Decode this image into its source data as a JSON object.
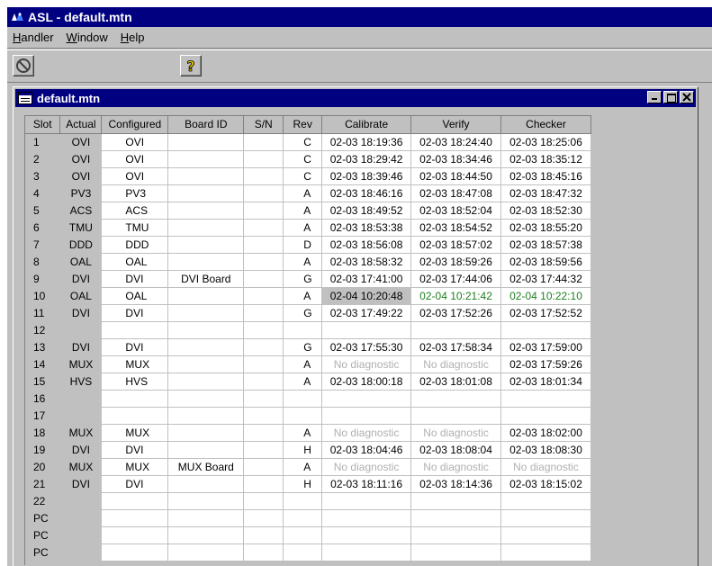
{
  "app": {
    "title": "ASL - default.mtn",
    "logo_text": "ASL"
  },
  "menu": [
    {
      "label": "Handler",
      "underline": "H",
      "rest": "andler"
    },
    {
      "label": "Window",
      "underline": "W",
      "rest": "indow"
    },
    {
      "label": "Help",
      "underline": "H",
      "rest": "elp"
    }
  ],
  "child": {
    "title": "default.mtn"
  },
  "grid": {
    "headers": [
      "Slot",
      "Actual",
      "Configured",
      "Board ID",
      "S/N",
      "Rev",
      "Calibrate",
      "Verify",
      "Checker"
    ],
    "rows": [
      {
        "slot": "1",
        "actual": "OVI",
        "configured": "OVI",
        "board_id": "",
        "sn": "",
        "rev": "C",
        "calibrate": "02-03 18:19:36",
        "verify": "02-03 18:24:40",
        "checker": "02-03 18:25:06"
      },
      {
        "slot": "2",
        "actual": "OVI",
        "configured": "OVI",
        "board_id": "",
        "sn": "",
        "rev": "C",
        "calibrate": "02-03 18:29:42",
        "verify": "02-03 18:34:46",
        "checker": "02-03 18:35:12"
      },
      {
        "slot": "3",
        "actual": "OVI",
        "configured": "OVI",
        "board_id": "",
        "sn": "",
        "rev": "C",
        "calibrate": "02-03 18:39:46",
        "verify": "02-03 18:44:50",
        "checker": "02-03 18:45:16"
      },
      {
        "slot": "4",
        "actual": "PV3",
        "configured": "PV3",
        "board_id": "",
        "sn": "",
        "rev": "A",
        "calibrate": "02-03 18:46:16",
        "verify": "02-03 18:47:08",
        "checker": "02-03 18:47:32"
      },
      {
        "slot": "5",
        "actual": "ACS",
        "configured": "ACS",
        "board_id": "",
        "sn": "",
        "rev": "A",
        "calibrate": "02-03 18:49:52",
        "verify": "02-03 18:52:04",
        "checker": "02-03 18:52:30"
      },
      {
        "slot": "6",
        "actual": "TMU",
        "configured": "TMU",
        "board_id": "",
        "sn": "",
        "rev": "A",
        "calibrate": "02-03 18:53:38",
        "verify": "02-03 18:54:52",
        "checker": "02-03 18:55:20"
      },
      {
        "slot": "7",
        "actual": "DDD",
        "configured": "DDD",
        "board_id": "",
        "sn": "",
        "rev": "D",
        "calibrate": "02-03 18:56:08",
        "verify": "02-03 18:57:02",
        "checker": "02-03 18:57:38"
      },
      {
        "slot": "8",
        "actual": "OAL",
        "configured": "OAL",
        "board_id": "",
        "sn": "",
        "rev": "A",
        "calibrate": "02-03 18:58:32",
        "verify": "02-03 18:59:26",
        "checker": "02-03 18:59:56"
      },
      {
        "slot": "9",
        "actual": "DVI",
        "configured": "DVI",
        "board_id": "DVI Board",
        "sn": "",
        "rev": "G",
        "calibrate": "02-03 17:41:00",
        "verify": "02-03 17:44:06",
        "checker": "02-03 17:44:32"
      },
      {
        "slot": "10",
        "actual": "OAL",
        "configured": "OAL",
        "board_id": "",
        "sn": "",
        "rev": "A",
        "calibrate": "02-04 10:20:48",
        "verify": "02-04 10:21:42",
        "checker": "02-04 10:22:10"
      },
      {
        "slot": "11",
        "actual": "DVI",
        "configured": "DVI",
        "board_id": "",
        "sn": "",
        "rev": "G",
        "calibrate": "02-03 17:49:22",
        "verify": "02-03 17:52:26",
        "checker": "02-03 17:52:52"
      },
      {
        "slot": "12",
        "actual": "",
        "configured": "",
        "board_id": "",
        "sn": "",
        "rev": "",
        "calibrate": "",
        "verify": "",
        "checker": ""
      },
      {
        "slot": "13",
        "actual": "DVI",
        "configured": "DVI",
        "board_id": "",
        "sn": "",
        "rev": "G",
        "calibrate": "02-03 17:55:30",
        "verify": "02-03 17:58:34",
        "checker": "02-03 17:59:00"
      },
      {
        "slot": "14",
        "actual": "MUX",
        "configured": "MUX",
        "board_id": "",
        "sn": "",
        "rev": "A",
        "calibrate": "No diagnostic",
        "verify": "No diagnostic",
        "checker": "02-03 17:59:26"
      },
      {
        "slot": "15",
        "actual": "HVS",
        "configured": "HVS",
        "board_id": "",
        "sn": "",
        "rev": "A",
        "calibrate": "02-03 18:00:18",
        "verify": "02-03 18:01:08",
        "checker": "02-03 18:01:34"
      },
      {
        "slot": "16",
        "actual": "",
        "configured": "",
        "board_id": "",
        "sn": "",
        "rev": "",
        "calibrate": "",
        "verify": "",
        "checker": ""
      },
      {
        "slot": "17",
        "actual": "",
        "configured": "",
        "board_id": "",
        "sn": "",
        "rev": "",
        "calibrate": "",
        "verify": "",
        "checker": ""
      },
      {
        "slot": "18",
        "actual": "MUX",
        "configured": "MUX",
        "board_id": "",
        "sn": "",
        "rev": "A",
        "calibrate": "No diagnostic",
        "verify": "No diagnostic",
        "checker": "02-03 18:02:00"
      },
      {
        "slot": "19",
        "actual": "DVI",
        "configured": "DVI",
        "board_id": "",
        "sn": "",
        "rev": "H",
        "calibrate": "02-03 18:04:46",
        "verify": "02-03 18:08:04",
        "checker": "02-03 18:08:30"
      },
      {
        "slot": "20",
        "actual": "MUX",
        "configured": "MUX",
        "board_id": "MUX Board",
        "sn": "",
        "rev": "A",
        "calibrate": "No diagnostic",
        "verify": "No diagnostic",
        "checker": "No diagnostic"
      },
      {
        "slot": "21",
        "actual": "DVI",
        "configured": "DVI",
        "board_id": "",
        "sn": "",
        "rev": "H",
        "calibrate": "02-03 18:11:16",
        "verify": "02-03 18:14:36",
        "checker": "02-03 18:15:02"
      },
      {
        "slot": "22",
        "actual": "",
        "configured": "",
        "board_id": "",
        "sn": "",
        "rev": "",
        "calibrate": "",
        "verify": "",
        "checker": ""
      },
      {
        "slot": "PC",
        "actual": "",
        "configured": "",
        "board_id": "",
        "sn": "",
        "rev": "",
        "calibrate": "",
        "verify": "",
        "checker": ""
      },
      {
        "slot": "PC",
        "actual": "",
        "configured": "",
        "board_id": "",
        "sn": "",
        "rev": "",
        "calibrate": "",
        "verify": "",
        "checker": ""
      },
      {
        "slot": "PC",
        "actual": "",
        "configured": "",
        "board_id": "",
        "sn": "",
        "rev": "",
        "calibrate": "",
        "verify": "",
        "checker": ""
      }
    ],
    "selected_cell": {
      "row": 9,
      "column": "calibrate"
    },
    "green_cells": [
      {
        "row": 9,
        "column": "verify"
      },
      {
        "row": 9,
        "column": "checker"
      }
    ]
  },
  "toolbar": {
    "icons": [
      "stop-icon",
      "help-icon"
    ]
  },
  "colors": {
    "titlebar": "#000080",
    "window": "#c0c0c0",
    "pass_green": "#208020",
    "disabled_text": "#b0b0b0"
  }
}
